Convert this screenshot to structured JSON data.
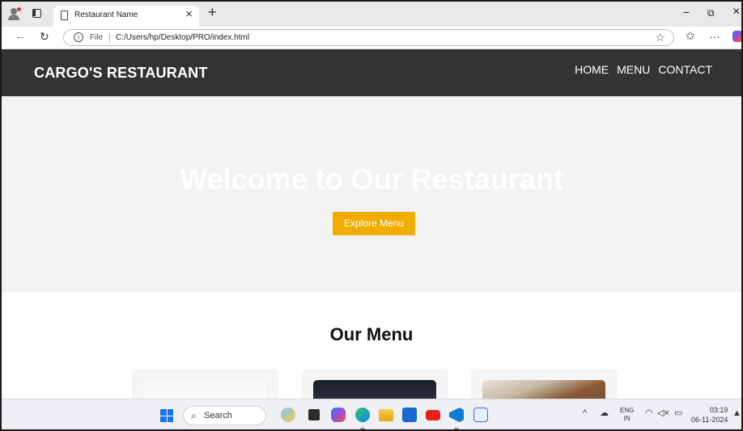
{
  "browser": {
    "tab_title": "Restaurant Name",
    "tab_close": "×",
    "new_tab": "+",
    "file_label": "File",
    "url": "C:/Users/hp/Desktop/PRO/index.html",
    "minimize": "−",
    "restore": "⧉",
    "close": "×"
  },
  "site": {
    "brand": "CARGO'S RESTAURANT",
    "nav": [
      "HOME",
      "MENU",
      "CONTACT"
    ],
    "hero_title": "Welcome to Our Restaurant",
    "hero_button": "Explore Menu",
    "menu_title": "Our Menu",
    "accent_color": "#f0ad00",
    "header_color": "#333333"
  },
  "taskbar": {
    "search_placeholder": "Search",
    "lang_top": "ENG",
    "lang_bottom": "IN",
    "time": "03:19",
    "date": "06-11-2024"
  }
}
